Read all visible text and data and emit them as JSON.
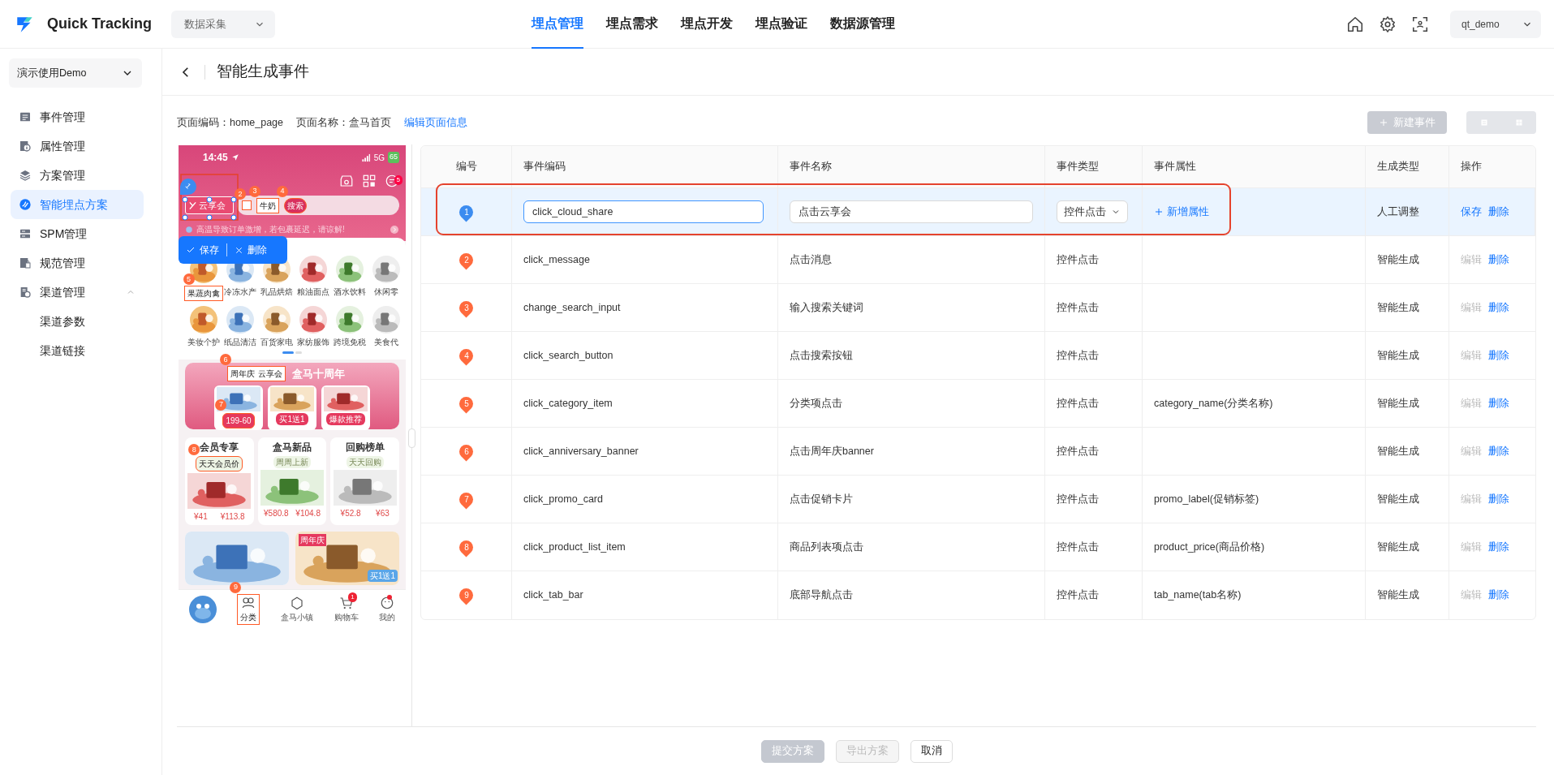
{
  "app": {
    "name": "Quick Tracking",
    "module": "数据采集",
    "user": "qt_demo"
  },
  "top_nav": [
    {
      "label": "埋点管理",
      "selected": true
    },
    {
      "label": "埋点需求",
      "selected": false
    },
    {
      "label": "埋点开发",
      "selected": false
    },
    {
      "label": "埋点验证",
      "selected": false
    },
    {
      "label": "数据源管理",
      "selected": false
    }
  ],
  "sidebar": {
    "workspace": "演示使用Demo",
    "items": [
      {
        "label": "事件管理",
        "selected": false
      },
      {
        "label": "属性管理",
        "selected": false
      },
      {
        "label": "方案管理",
        "selected": false
      },
      {
        "label": "智能埋点方案",
        "selected": true
      },
      {
        "label": "SPM管理",
        "selected": false
      },
      {
        "label": "规范管理",
        "selected": false
      },
      {
        "label": "渠道管理",
        "selected": false,
        "expanded": true,
        "children": [
          {
            "label": "渠道参数",
            "selected": false
          },
          {
            "label": "渠道链接",
            "selected": false
          }
        ]
      }
    ]
  },
  "page": {
    "title": "智能生成事件",
    "info": [
      "页面编码：home_page",
      "页面名称：盒马首页"
    ],
    "edit_link": "编辑页面信息",
    "new_button": {
      "label": "新建事件",
      "disabled": true
    }
  },
  "phone_preview": {
    "time": "14:45",
    "network": "5G",
    "battery": "65",
    "message_badge": "5",
    "brand": {
      "text": "云享会",
      "marker": "1",
      "selected": true
    },
    "scan_marker": {
      "marker": "2",
      "selected": false
    },
    "search_text": {
      "text": "牛奶",
      "marker": "3",
      "selected": false
    },
    "search_button": {
      "text": "搜索",
      "marker": "4",
      "selected": false
    },
    "notice": "高温导致订单激增，若包裹延迟，请谅解!",
    "edit_toolbar": {
      "save": "保存",
      "delete": "删除"
    },
    "categories": [
      {
        "label": "果蔬肉禽",
        "marker": "5",
        "selected": false
      },
      {
        "label": "冷冻水产"
      },
      {
        "label": "乳品烘焙"
      },
      {
        "label": "粮油面点"
      },
      {
        "label": "酒水饮料"
      },
      {
        "label": "休闲零"
      },
      {
        "label": "美妆个护"
      },
      {
        "label": "纸品清洁"
      },
      {
        "label": "百货家电"
      },
      {
        "label": "家纺服饰"
      },
      {
        "label": "跨境免税"
      },
      {
        "label": "美食代"
      }
    ],
    "banner": {
      "tag": "周年庆",
      "tag_brand": "云享会",
      "marker": "6",
      "selected": false,
      "title": "盒马十周年",
      "offers": [
        {
          "label": "199-60",
          "marker": "7",
          "selected": false
        },
        {
          "label": "买1送1"
        },
        {
          "label": "爆款推荐"
        }
      ]
    },
    "sections": [
      {
        "title": "会员专享",
        "tag": "天天会员价",
        "marker": "8",
        "selected": false,
        "prices": [
          "¥41",
          "¥113.8"
        ]
      },
      {
        "title": "盒马新品",
        "tag": "周周上新",
        "prices": [
          "¥580.8",
          "¥104.8"
        ]
      },
      {
        "title": "回购榜单",
        "tag": "天天回购",
        "prices": [
          "¥52.8",
          "¥63"
        ]
      }
    ],
    "promo": {
      "tag": "周年庆",
      "sticker": "买1送1"
    },
    "tab_bar": [
      {
        "label": "分类",
        "marker": "9",
        "selected": false,
        "dot": false
      },
      {
        "label": "盒马小镇",
        "dot": false
      },
      {
        "label": "购物车",
        "badge": "1",
        "dot": false
      },
      {
        "label": "我的",
        "dot": true
      }
    ]
  },
  "table": {
    "columns": [
      "编号",
      "事件编码",
      "事件名称",
      "事件类型",
      "事件属性",
      "生成类型",
      "操作"
    ],
    "rows": [
      {
        "number": "1",
        "code": "click_cloud_share",
        "name": "点击云享会",
        "type": "控件点击",
        "add_attribute": "新增属性",
        "generation": "人工调整",
        "selected": true,
        "editing": true,
        "actions": [
          {
            "label": "保存",
            "disabled": false
          },
          {
            "label": "删除",
            "disabled": false
          }
        ]
      },
      {
        "number": "2",
        "code": "click_message",
        "name": "点击消息",
        "type": "控件点击",
        "generation": "智能生成",
        "selected": false,
        "editing": false,
        "actions": [
          {
            "label": "编辑",
            "disabled": true
          },
          {
            "label": "删除",
            "disabled": false
          }
        ]
      },
      {
        "number": "3",
        "code": "change_search_input",
        "name": "输入搜索关键词",
        "type": "控件点击",
        "generation": "智能生成",
        "selected": false,
        "editing": false,
        "actions": [
          {
            "label": "编辑",
            "disabled": true
          },
          {
            "label": "删除",
            "disabled": false
          }
        ]
      },
      {
        "number": "4",
        "code": "click_search_button",
        "name": "点击搜索按钮",
        "type": "控件点击",
        "generation": "智能生成",
        "selected": false,
        "editing": false,
        "actions": [
          {
            "label": "编辑",
            "disabled": true
          },
          {
            "label": "删除",
            "disabled": false
          }
        ]
      },
      {
        "number": "5",
        "code": "click_category_item",
        "name": "分类项点击",
        "type": "控件点击",
        "attribute": "category_name(分类名称)",
        "generation": "智能生成",
        "selected": false,
        "editing": false,
        "actions": [
          {
            "label": "编辑",
            "disabled": true
          },
          {
            "label": "删除",
            "disabled": false
          }
        ]
      },
      {
        "number": "6",
        "code": "click_anniversary_banner",
        "name": "点击周年庆banner",
        "type": "控件点击",
        "generation": "智能生成",
        "selected": false,
        "editing": false,
        "actions": [
          {
            "label": "编辑",
            "disabled": true
          },
          {
            "label": "删除",
            "disabled": false
          }
        ]
      },
      {
        "number": "7",
        "code": "click_promo_card",
        "name": "点击促销卡片",
        "type": "控件点击",
        "attribute": "promo_label(促销标签)",
        "generation": "智能生成",
        "selected": false,
        "editing": false,
        "actions": [
          {
            "label": "编辑",
            "disabled": true
          },
          {
            "label": "删除",
            "disabled": false
          }
        ]
      },
      {
        "number": "8",
        "code": "click_product_list_item",
        "name": "商品列表项点击",
        "type": "控件点击",
        "attribute": "product_price(商品价格)",
        "generation": "智能生成",
        "selected": false,
        "editing": false,
        "actions": [
          {
            "label": "编辑",
            "disabled": true
          },
          {
            "label": "删除",
            "disabled": false
          }
        ]
      },
      {
        "number": "9",
        "code": "click_tab_bar",
        "name": "底部导航点击",
        "type": "控件点击",
        "attribute": "tab_name(tab名称)",
        "generation": "智能生成",
        "selected": false,
        "editing": false,
        "actions": [
          {
            "label": "编辑",
            "disabled": true
          },
          {
            "label": "删除",
            "disabled": false
          }
        ]
      }
    ]
  },
  "footer_buttons": [
    {
      "label": "提交方案",
      "kind": "primary",
      "disabled": true
    },
    {
      "label": "导出方案",
      "kind": "default",
      "disabled": true
    },
    {
      "label": "取消",
      "kind": "default",
      "disabled": false
    }
  ]
}
